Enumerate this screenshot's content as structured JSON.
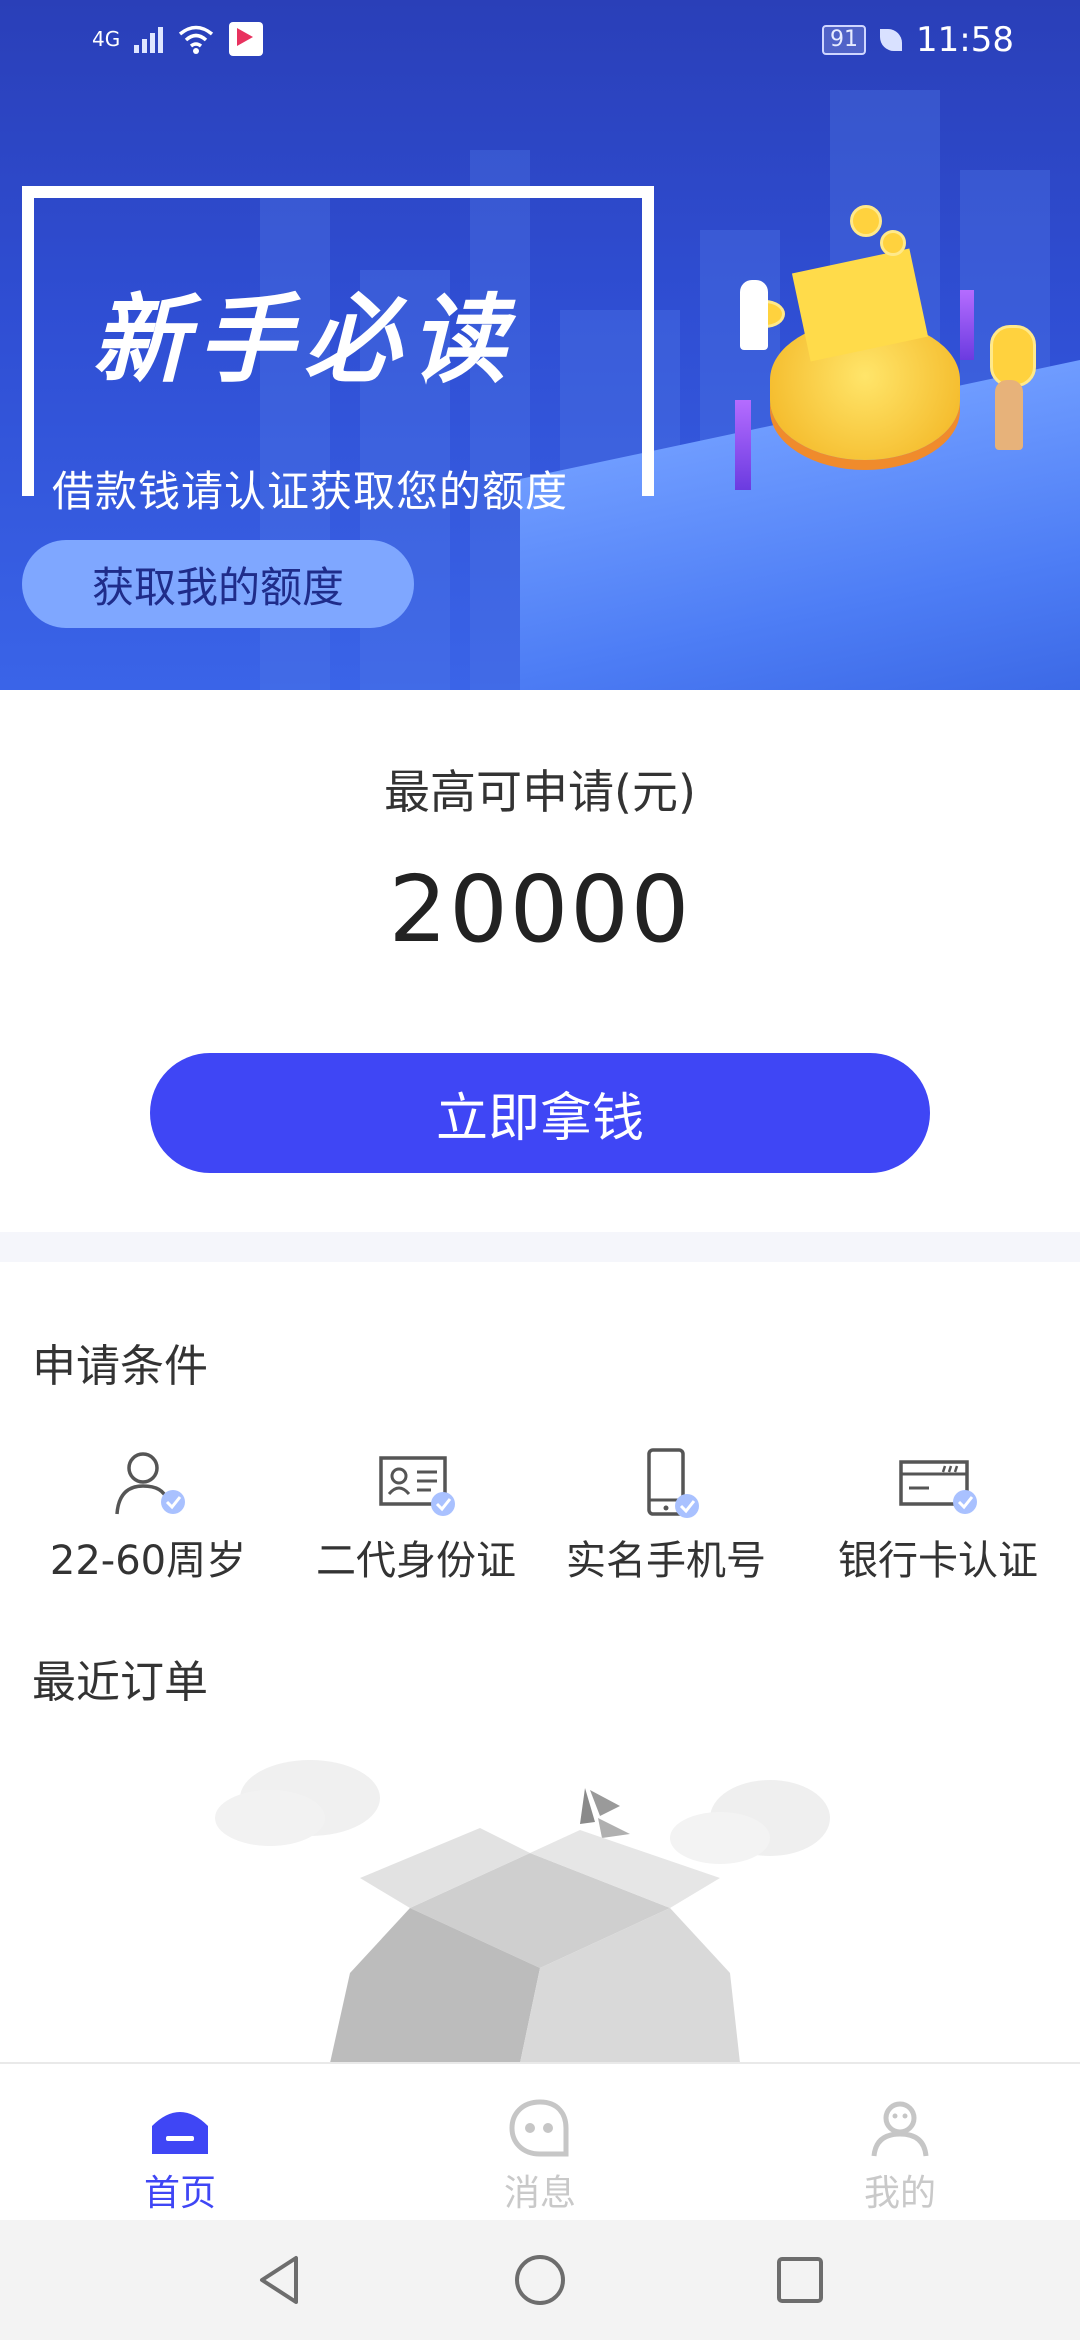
{
  "status": {
    "time": "11:58",
    "battery": "91",
    "network": "4G"
  },
  "banner": {
    "title": "新手必读",
    "subtitle": "借款钱请认证获取您的额度",
    "button_label": "获取我的额度"
  },
  "loan": {
    "max_label": "最高可申请(元)",
    "max_amount": "20000",
    "apply_button": "立即拿钱"
  },
  "conditions": {
    "title": "申请条件",
    "items": [
      {
        "label": "22-60周岁",
        "icon": "person-check-icon"
      },
      {
        "label": "二代身份证",
        "icon": "id-card-check-icon"
      },
      {
        "label": "实名手机号",
        "icon": "phone-check-icon"
      },
      {
        "label": "银行卡认证",
        "icon": "bank-card-check-icon"
      }
    ]
  },
  "orders": {
    "title": "最近订单",
    "empty_icon": "empty-box-icon"
  },
  "tabs": [
    {
      "label": "首页",
      "icon": "home-icon",
      "active": true
    },
    {
      "label": "消息",
      "icon": "message-icon",
      "active": false
    },
    {
      "label": "我的",
      "icon": "profile-icon",
      "active": false
    }
  ],
  "colors": {
    "primary": "#3f46f5",
    "banner_blue": "#2f4ed3",
    "inactive": "#c9c9c9"
  }
}
